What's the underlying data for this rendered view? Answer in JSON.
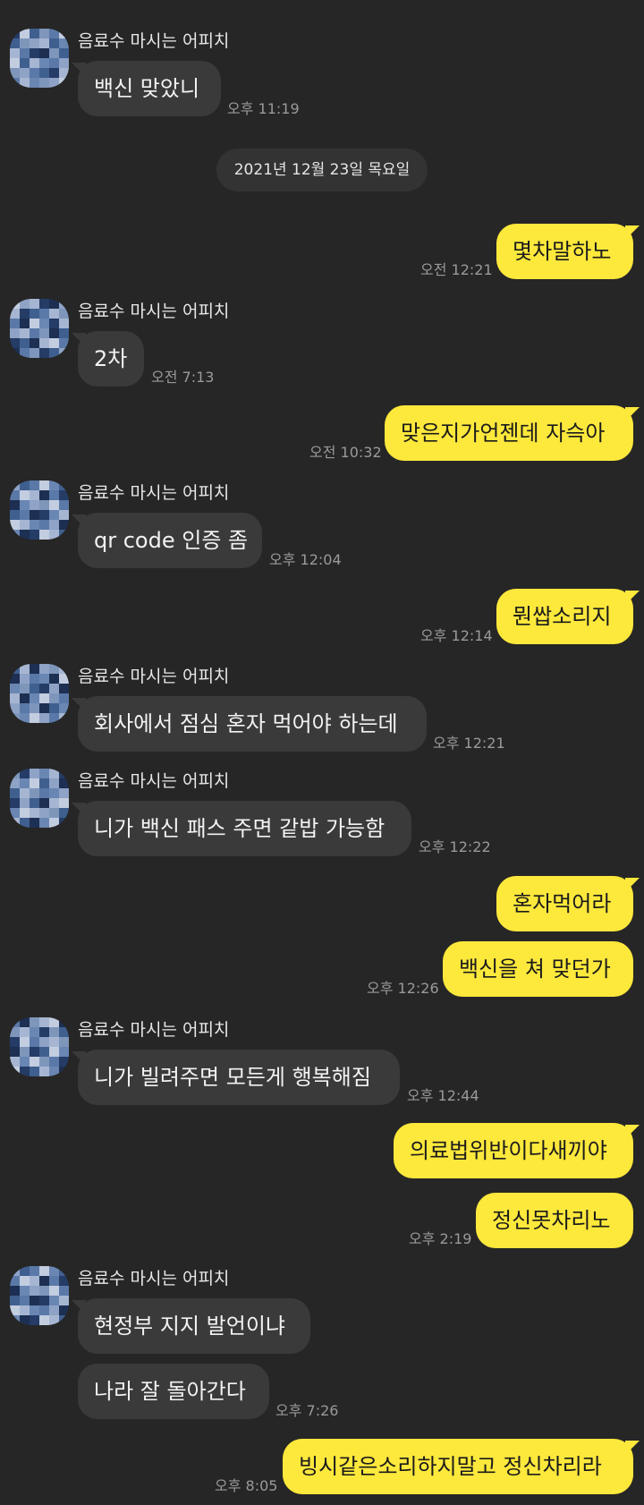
{
  "date_divider": "2021년 12월 23일 목요일",
  "sender_name": "음료수 마시는 어피치",
  "colors": {
    "background": "#262626",
    "incoming_bubble": "#3a3a3a",
    "outgoing_bubble": "#fde83c",
    "timestamp": "#9a9a9a"
  },
  "messages": [
    {
      "side": "in",
      "text": "백신 맞았니",
      "time": "오후 11:19"
    },
    {
      "side": "out",
      "text": "몇차말하노",
      "time": "오전 12:21"
    },
    {
      "side": "in",
      "text": "2차",
      "time": "오전 7:13"
    },
    {
      "side": "out",
      "text": "맞은지가언젠데 자슥아",
      "time": "오전 10:32"
    },
    {
      "side": "in",
      "text": "qr code 인증 좀",
      "time": "오후 12:04"
    },
    {
      "side": "out",
      "text": "뭔쌉소리지",
      "time": "오후 12:14"
    },
    {
      "side": "in",
      "text": "회사에서 점심 혼자 먹어야 하는데",
      "time": "오후 12:21"
    },
    {
      "side": "in",
      "text": "니가 백신 패스 주면 같밥 가능함",
      "time": "오후 12:22"
    },
    {
      "side": "out",
      "text": "혼자먹어라",
      "time": ""
    },
    {
      "side": "out",
      "text": "백신을 쳐 맞던가",
      "time": "오후 12:26"
    },
    {
      "side": "in",
      "text": "니가 빌려주면 모든게 행복해짐",
      "time": "오후 12:44"
    },
    {
      "side": "out",
      "text": "의료법위반이다새끼야",
      "time": ""
    },
    {
      "side": "out",
      "text": "정신못차리노",
      "time": "오후 2:19"
    },
    {
      "side": "in",
      "text": "현정부 지지 발언이냐",
      "time": ""
    },
    {
      "side": "in",
      "text": "나라 잘 돌아간다",
      "time": "오후 7:26"
    },
    {
      "side": "out",
      "text": "빙시같은소리하지말고 정신차리라",
      "time": "오후 8:05"
    }
  ]
}
